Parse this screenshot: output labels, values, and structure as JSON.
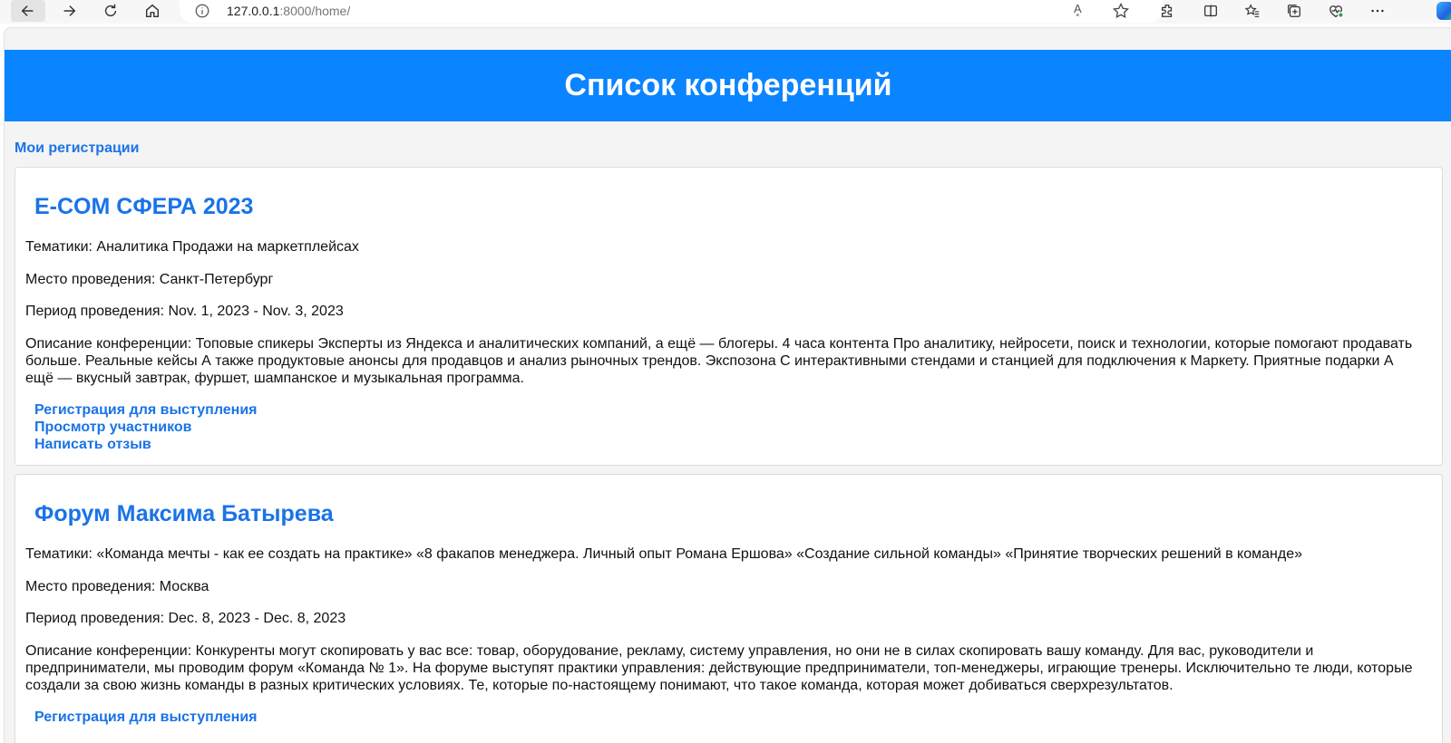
{
  "browser": {
    "url_host": "127.0.0.1",
    "url_rest": ":8000/home/",
    "read_aloud": "A͓"
  },
  "page": {
    "title": "Список конференций",
    "my_registrations": "Мои регистрации"
  },
  "conferences": [
    {
      "name": "E-COM СФЕРА 2023",
      "topics": "Тематики: Аналитика Продажи на маркетплейсах",
      "place": "Место проведения: Санкт-Петербург",
      "period": "Период проведения: Nov. 1, 2023 - Nov. 3, 2023",
      "description": "Описание конференции: Топовые спикеры Эксперты из Яндекса и аналитических компаний, а ещё — блогеры. 4 часа контента Про аналитику, нейросети, поиск и технологии, которые помогают продавать больше. Реальные кейсы А также продуктовые анонсы для продавцов и анализ рыночных трендов. Экспозона С интерактивными стендами и станцией для подключения к Маркету. Приятные подарки А ещё — вкусный завтрак, фуршет, шампанское и музыкальная программа.",
      "links": [
        "Регистрация для выступления",
        "Просмотр участников",
        "Написать отзыв"
      ]
    },
    {
      "name": "Форум Максима Батырева",
      "topics": "Тематики: «Команда мечты - как ее создать на практике» «8 факапов менеджера. Личный опыт Романа Ершова» «Создание сильной команды» «Принятие творческих решений в команде»",
      "place": "Место проведения: Москва",
      "period": "Период проведения: Dec. 8, 2023 - Dec. 8, 2023",
      "description": "Описание конференции: Конкуренты могут скопировать у вас все: товар, оборудование, рекламу, систему управления, но они не в силах скопировать вашу команду. Для вас, руководители и предприниматели, мы проводим форум «Команда № 1». На форуме выступят практики управления: действующие предприниматели, топ-менеджеры, играющие тренеры. Исключительно те люди, которые создали за свою жизнь команды в разных критических условиях. Те, которые по-настоящему понимают, что такое команда, которая может добиваться сверхрезультатов.",
      "links": [
        "Регистрация для выступления"
      ]
    }
  ]
}
